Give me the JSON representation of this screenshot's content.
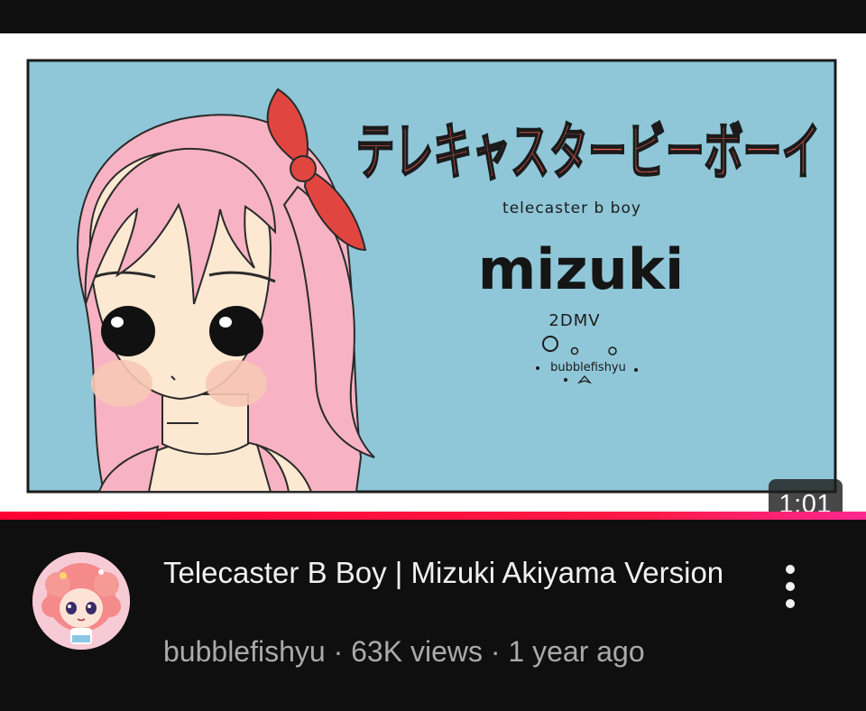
{
  "video": {
    "thumbnail": {
      "title_jp": "テレキャスタービーボーイ",
      "subtitle_en": "telecaster b boy",
      "character_name": "mizuki",
      "format_label": "2DMV",
      "artist_signature": "bubblefishyu",
      "colors": {
        "background": "#8fc7d8",
        "hair": "#f7b3c3",
        "bow": "#e0463f",
        "skin": "#fde8d2"
      }
    },
    "duration": "1:01",
    "watch_progress_fraction": 1.0,
    "title": "Telecaster B Boy | Mizuki Akiyama Version",
    "channel": "bubblefishyu",
    "views": "63K views",
    "age": "1 year ago",
    "separator": "·"
  },
  "icons": {
    "menu": "more-vertical-icon",
    "avatar": "channel-avatar"
  },
  "colors": {
    "progress": "#ff0033",
    "page_bg": "#0f0f0f",
    "title_text": "#f1f1f1",
    "meta_text": "#aaaaaa"
  }
}
